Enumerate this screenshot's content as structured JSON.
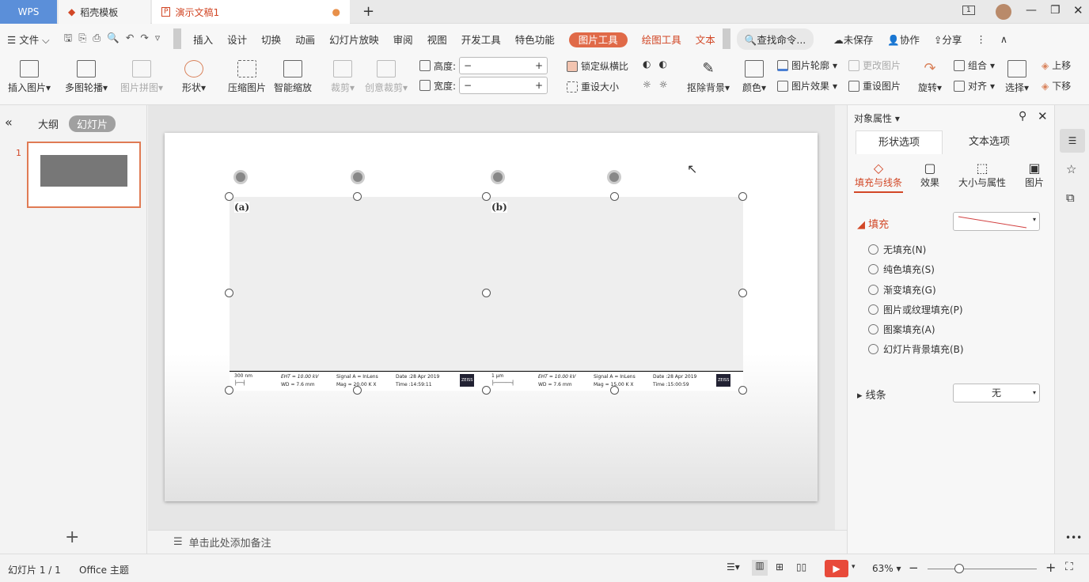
{
  "tabs": [
    {
      "label": "WPS"
    },
    {
      "label": "稻壳模板"
    },
    {
      "label": "演示文稿1"
    }
  ],
  "menu": {
    "file": "文件",
    "items": [
      "插入",
      "设计",
      "切换",
      "动画",
      "幻灯片放映",
      "审阅",
      "视图",
      "开发工具",
      "特色功能"
    ],
    "picture_tools": "图片工具",
    "drawing_tools": "绘图工具",
    "text_tools": "文本",
    "search": "查找命令...",
    "unsaved": "未保存",
    "collab": "协作",
    "share": "分享"
  },
  "ribbon": {
    "insert_picture": "插入图片",
    "multi_carousel": "多图轮播",
    "collage": "图片拼图",
    "shape": "形状",
    "compress": "压缩图片",
    "smart_zoom": "智能缩放",
    "crop": "裁剪",
    "creative_crop": "创意裁剪",
    "height": "高度:",
    "width": "宽度:",
    "lock_ratio": "锁定纵横比",
    "reset_size": "重设大小",
    "remove_bg": "抠除背景",
    "color": "颜色",
    "outline": "图片轮廓",
    "effects": "图片效果",
    "change_pic": "更改图片",
    "reset_pic": "重设图片",
    "rotate": "旋转",
    "group": "组合",
    "align": "对齐",
    "select": "选择",
    "bring_up": "上移",
    "send_down": "下移"
  },
  "left_panel": {
    "outline_tab": "大纲",
    "slides_tab": "幻灯片",
    "slide_number": "1"
  },
  "slide": {
    "images": [
      {
        "label": "(a)",
        "scale": "300 nm",
        "eht": "EHT = 10.00 kV",
        "wd": "WD = 7.6 mm",
        "signal": "Signal A = InLens",
        "mag": "Mag =  20.00 K X",
        "date": "Date :28 Apr 2019",
        "time": "Time :14:59:11",
        "logo": "ZEISS"
      },
      {
        "label": "(b)",
        "scale": "1 μm",
        "eht": "EHT = 10.00 kV",
        "wd": "WD = 7.6 mm",
        "signal": "Signal A = InLens",
        "mag": "Mag =  15.00 K X",
        "date": "Date :28 Apr 2019",
        "time": "Time :15:00:59",
        "logo": "ZEISS"
      }
    ]
  },
  "notes_placeholder": "单击此处添加备注",
  "pane": {
    "title": "对象属性",
    "tab_shape": "形状选项",
    "tab_text": "文本选项",
    "sub": [
      "填充与线条",
      "效果",
      "大小与属性",
      "图片"
    ],
    "fill_label": "填充",
    "fill_options": [
      "无填充(N)",
      "纯色填充(S)",
      "渐变填充(G)",
      "图片或纹理填充(P)",
      "图案填充(A)",
      "幻灯片背景填充(B)"
    ],
    "line_label": "线条",
    "line_value": "无"
  },
  "status": {
    "slide_count": "幻灯片 1 / 1",
    "theme": "Office 主题",
    "zoom": "63%"
  },
  "colors": {
    "accent": "#d24726",
    "wps_blue": "#5b8fd9",
    "picture_tools_pill": "#e06a48"
  }
}
